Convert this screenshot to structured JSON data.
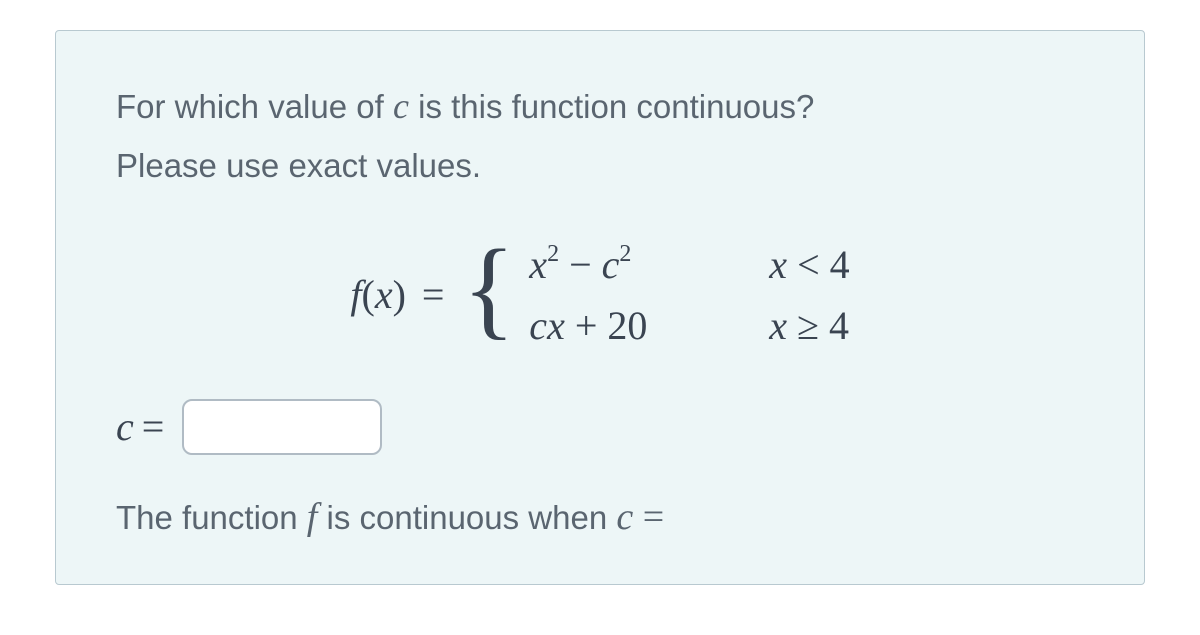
{
  "question": {
    "text_before_c": "For which value of ",
    "var_c": "c",
    "text_after_c": " is this function continuous?",
    "instruction": "Please use exact values."
  },
  "formula": {
    "lhs_f": "f",
    "lhs_open": "(",
    "lhs_x": "x",
    "lhs_close": ")",
    "equals": "=",
    "brace": "{",
    "case1": {
      "x": "x",
      "sq1": "2",
      "minus": " − ",
      "c": "c",
      "sq2": "2",
      "cond_x": "x",
      "cond_rel": " < ",
      "cond_val": "4"
    },
    "case2": {
      "c": "c",
      "x": "x",
      "plus": " + ",
      "val": "20",
      "cond_x": "x",
      "cond_rel": " ≥ ",
      "cond_val": "4"
    }
  },
  "answer": {
    "c_label": "c",
    "equals": "=",
    "input_value": ""
  },
  "conclusion": {
    "text1": "The function ",
    "f": "f",
    "text2": " is continuous when ",
    "c": "c",
    "equals": " ="
  }
}
